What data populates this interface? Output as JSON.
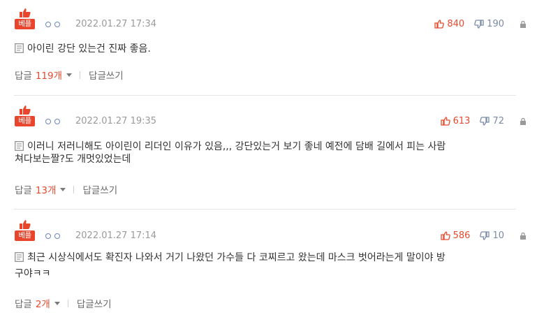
{
  "comments": [
    {
      "badge": "베플",
      "timestamp": "2022.01.27 17:34",
      "up_votes": "840",
      "down_votes": "190",
      "lines": [
        "아이린 강단 있는건 진짜 좋음."
      ],
      "reply_label": "답글",
      "reply_count": "119개",
      "write_reply": "답글쓰기"
    },
    {
      "badge": "베플",
      "timestamp": "2022.01.27 19:35",
      "up_votes": "613",
      "down_votes": "72",
      "lines": [
        "이러니 저러니해도 아이린이 리더인 이유가 있음,,, 강단있는거 보기 좋네 예전에 담배 길에서 피는 사람",
        "쳐다보는짤?도 개멋있었는데"
      ],
      "reply_label": "답글",
      "reply_count": "13개",
      "write_reply": "답글쓰기"
    },
    {
      "badge": "베플",
      "timestamp": "2022.01.27 17:14",
      "up_votes": "586",
      "down_votes": "10",
      "lines": [
        "최근 시상식에서도 확진자 나와서 거기 나왔던 가수들 다 코찌르고 왔는데 마스크 벗어라는게 말이야 방",
        "구야ㅋㅋ"
      ],
      "reply_label": "답글",
      "reply_count": "2개",
      "write_reply": "답글쓰기"
    }
  ],
  "colors": {
    "accent_red": "#e54b2e",
    "badge_red": "#e8452c",
    "down_gray_blue": "#7a8aa6",
    "circle_blue": "#6a86b8"
  },
  "icons": {
    "badge": "thumbs-up-icon",
    "up": "thumbs-up-icon",
    "down": "thumbs-down-icon",
    "report": "lock-icon",
    "body": "document-icon"
  }
}
